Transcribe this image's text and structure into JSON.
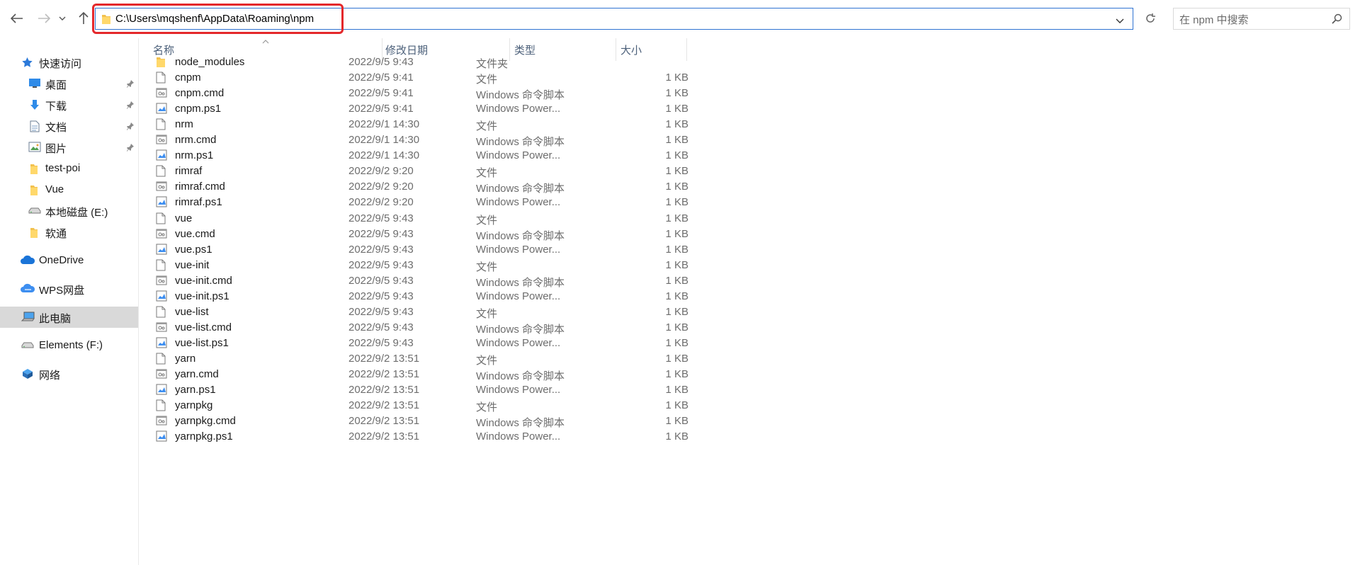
{
  "toolbar": {
    "back": "back-arrow",
    "forward": "forward-arrow",
    "recent": "chevron-down",
    "up": "up-arrow",
    "address": "C:\\Users\\mqshenf\\AppData\\Roaming\\npm",
    "search_placeholder": "在 npm 中搜索",
    "highlight_color": "#e4282b"
  },
  "sidebar": {
    "items": [
      {
        "label": "快速访问",
        "icon": "star"
      },
      {
        "label": "桌面",
        "icon": "desktop",
        "pinned": true
      },
      {
        "label": "下载",
        "icon": "download",
        "pinned": true
      },
      {
        "label": "文档",
        "icon": "document",
        "pinned": true
      },
      {
        "label": "图片",
        "icon": "picture",
        "pinned": true
      },
      {
        "label": "test-poi",
        "icon": "folder"
      },
      {
        "label": "Vue",
        "icon": "folder"
      },
      {
        "label": "本地磁盘 (E:)",
        "icon": "drive"
      },
      {
        "label": "软通",
        "icon": "folder"
      },
      {
        "label": "OneDrive",
        "icon": "cloud"
      },
      {
        "label": "WPS网盘",
        "icon": "cloud"
      },
      {
        "label": "此电脑",
        "icon": "computer",
        "selected": true
      },
      {
        "label": "Elements (F:)",
        "icon": "drive"
      },
      {
        "label": "网络",
        "icon": "network"
      }
    ]
  },
  "columns": {
    "name": "名称",
    "date": "修改日期",
    "type": "类型",
    "size": "大小"
  },
  "files": [
    {
      "name": "node_modules",
      "date": "2022/9/5 9:43",
      "type": "文件夹",
      "size": "",
      "kind": "folder"
    },
    {
      "name": "cnpm",
      "date": "2022/9/5 9:41",
      "type": "文件",
      "size": "1 KB",
      "kind": "file"
    },
    {
      "name": "cnpm.cmd",
      "date": "2022/9/5 9:41",
      "type": "Windows 命令脚本",
      "size": "1 KB",
      "kind": "cmd"
    },
    {
      "name": "cnpm.ps1",
      "date": "2022/9/5 9:41",
      "type": "Windows Power...",
      "size": "1 KB",
      "kind": "ps1"
    },
    {
      "name": "nrm",
      "date": "2022/9/1 14:30",
      "type": "文件",
      "size": "1 KB",
      "kind": "file"
    },
    {
      "name": "nrm.cmd",
      "date": "2022/9/1 14:30",
      "type": "Windows 命令脚本",
      "size": "1 KB",
      "kind": "cmd"
    },
    {
      "name": "nrm.ps1",
      "date": "2022/9/1 14:30",
      "type": "Windows Power...",
      "size": "1 KB",
      "kind": "ps1"
    },
    {
      "name": "rimraf",
      "date": "2022/9/2 9:20",
      "type": "文件",
      "size": "1 KB",
      "kind": "file"
    },
    {
      "name": "rimraf.cmd",
      "date": "2022/9/2 9:20",
      "type": "Windows 命令脚本",
      "size": "1 KB",
      "kind": "cmd"
    },
    {
      "name": "rimraf.ps1",
      "date": "2022/9/2 9:20",
      "type": "Windows Power...",
      "size": "1 KB",
      "kind": "ps1"
    },
    {
      "name": "vue",
      "date": "2022/9/5 9:43",
      "type": "文件",
      "size": "1 KB",
      "kind": "file"
    },
    {
      "name": "vue.cmd",
      "date": "2022/9/5 9:43",
      "type": "Windows 命令脚本",
      "size": "1 KB",
      "kind": "cmd"
    },
    {
      "name": "vue.ps1",
      "date": "2022/9/5 9:43",
      "type": "Windows Power...",
      "size": "1 KB",
      "kind": "ps1"
    },
    {
      "name": "vue-init",
      "date": "2022/9/5 9:43",
      "type": "文件",
      "size": "1 KB",
      "kind": "file"
    },
    {
      "name": "vue-init.cmd",
      "date": "2022/9/5 9:43",
      "type": "Windows 命令脚本",
      "size": "1 KB",
      "kind": "cmd"
    },
    {
      "name": "vue-init.ps1",
      "date": "2022/9/5 9:43",
      "type": "Windows Power...",
      "size": "1 KB",
      "kind": "ps1"
    },
    {
      "name": "vue-list",
      "date": "2022/9/5 9:43",
      "type": "文件",
      "size": "1 KB",
      "kind": "file"
    },
    {
      "name": "vue-list.cmd",
      "date": "2022/9/5 9:43",
      "type": "Windows 命令脚本",
      "size": "1 KB",
      "kind": "cmd"
    },
    {
      "name": "vue-list.ps1",
      "date": "2022/9/5 9:43",
      "type": "Windows Power...",
      "size": "1 KB",
      "kind": "ps1"
    },
    {
      "name": "yarn",
      "date": "2022/9/2 13:51",
      "type": "文件",
      "size": "1 KB",
      "kind": "file"
    },
    {
      "name": "yarn.cmd",
      "date": "2022/9/2 13:51",
      "type": "Windows 命令脚本",
      "size": "1 KB",
      "kind": "cmd"
    },
    {
      "name": "yarn.ps1",
      "date": "2022/9/2 13:51",
      "type": "Windows Power...",
      "size": "1 KB",
      "kind": "ps1"
    },
    {
      "name": "yarnpkg",
      "date": "2022/9/2 13:51",
      "type": "文件",
      "size": "1 KB",
      "kind": "file"
    },
    {
      "name": "yarnpkg.cmd",
      "date": "2022/9/2 13:51",
      "type": "Windows 命令脚本",
      "size": "1 KB",
      "kind": "cmd"
    },
    {
      "name": "yarnpkg.ps1",
      "date": "2022/9/2 13:51",
      "type": "Windows Power...",
      "size": "1 KB",
      "kind": "ps1"
    }
  ]
}
